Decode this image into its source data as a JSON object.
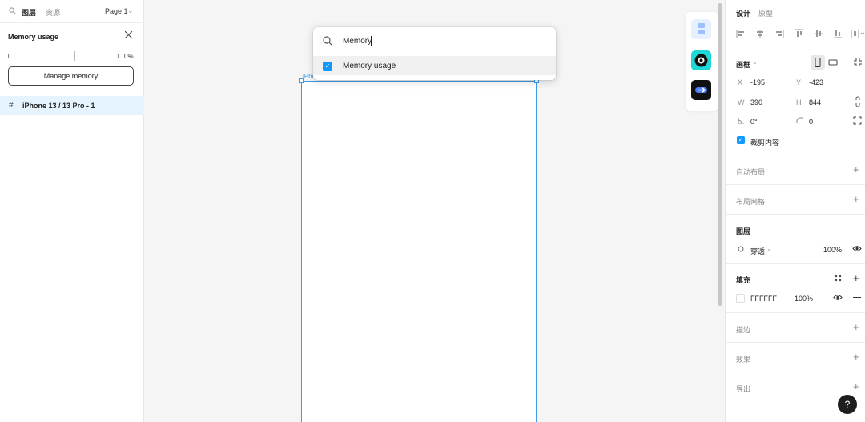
{
  "left_panel": {
    "tabs": {
      "layers": "图层",
      "assets": "资源"
    },
    "page_selector": "Page 1",
    "memory": {
      "title": "Memory usage",
      "percent": "0%",
      "usage_fraction": 0.0,
      "manage_button": "Manage memory"
    },
    "layers": [
      {
        "name": "iPhone 13 / 13 Pro - 1"
      }
    ]
  },
  "canvas": {
    "frame_label": "iPho",
    "popup": {
      "search_value": "Memory",
      "result_label": "Memory usage"
    }
  },
  "right_panel": {
    "tabs": {
      "design": "设计",
      "prototype": "原型"
    },
    "frame": {
      "section_label": "画框",
      "x_label": "X",
      "x_value": "-195",
      "y_label": "Y",
      "y_value": "-423",
      "w_label": "W",
      "w_value": "390",
      "h_label": "H",
      "h_value": "844",
      "rotation_value": "0°",
      "radius_value": "0",
      "clip_label": "裁剪内容"
    },
    "auto_layout": "自动布局",
    "layout_grid": "布局网格",
    "layer": {
      "title": "图层",
      "blend_mode": "穿透",
      "opacity": "100%"
    },
    "fill": {
      "title": "填充",
      "hex": "FFFFFF",
      "opacity": "100%",
      "swatch_color": "#FFFFFF"
    },
    "stroke": "描边",
    "effects": "效果",
    "export": "导出",
    "help": "?"
  },
  "colors": {
    "accent": "#0d99ff",
    "selection": "#3d9be9",
    "layer_highlight": "#e5f4ff"
  }
}
